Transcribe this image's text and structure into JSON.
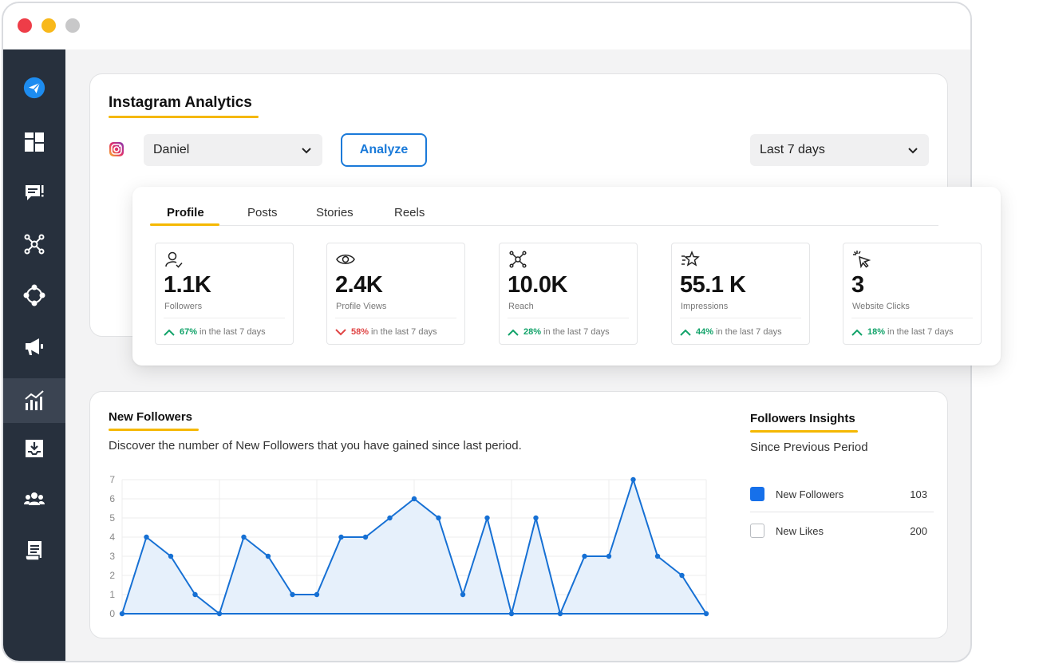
{
  "window": {
    "controls": [
      "close",
      "minimize",
      "maximize"
    ]
  },
  "sidebar": {
    "items": [
      {
        "icon": "paper-plane-logo-icon",
        "active": false
      },
      {
        "icon": "dashboard-grid-icon",
        "active": false
      },
      {
        "icon": "chat-message-icon",
        "active": false
      },
      {
        "icon": "network-hub-icon",
        "active": false
      },
      {
        "icon": "workflow-nodes-icon",
        "active": false
      },
      {
        "icon": "megaphone-icon",
        "active": false
      },
      {
        "icon": "analytics-chart-icon",
        "active": true
      },
      {
        "icon": "inbox-download-icon",
        "active": false
      },
      {
        "icon": "team-users-icon",
        "active": false
      },
      {
        "icon": "report-document-icon",
        "active": false
      }
    ]
  },
  "analytics": {
    "title": "Instagram Analytics",
    "account_select": "Daniel",
    "analyze_label": "Analyze",
    "period_select": "Last 7 days"
  },
  "tabs": [
    "Profile",
    "Posts",
    "Stories",
    "Reels"
  ],
  "metrics": [
    {
      "icon": "user-check-icon",
      "value": "1.1K",
      "label": "Followers",
      "pct": "67%",
      "trend": "up",
      "suffix": "in the last 7 days"
    },
    {
      "icon": "eye-icon",
      "value": "2.4K",
      "label": "Profile Views",
      "pct": "58%",
      "trend": "down",
      "suffix": "in the last 7 days"
    },
    {
      "icon": "reach-nodes-icon",
      "value": "10.0K",
      "label": "Reach",
      "pct": "28%",
      "trend": "up",
      "suffix": "in the last 7 days"
    },
    {
      "icon": "star-sparkle-icon",
      "value": "55.1 K",
      "label": "Impressions",
      "pct": "44%",
      "trend": "up",
      "suffix": "in the last 7 days"
    },
    {
      "icon": "cursor-click-icon",
      "value": "3",
      "label": "Website Clicks",
      "pct": "18%",
      "trend": "up",
      "suffix": "in the last 7 days"
    }
  ],
  "new_followers": {
    "title": "New Followers",
    "description": "Discover the number of New Followers that you have gained since last period."
  },
  "insights": {
    "title": "Followers Insights",
    "subtitle": "Since Previous Period",
    "items": [
      {
        "label": "New Followers",
        "value": "103",
        "checked": true
      },
      {
        "label": "New Likes",
        "value": "200",
        "checked": false
      }
    ]
  },
  "colors": {
    "accent": "#1a7ad9",
    "highlight": "#f5b800",
    "sidebar_bg": "#27303d",
    "up": "#12a36a",
    "down": "#e04545",
    "line": "#1670d4",
    "area": "#e6f0fb"
  },
  "chart_data": {
    "type": "area",
    "title": "",
    "xlabel": "",
    "ylabel": "",
    "ylim": [
      0,
      7
    ],
    "yticks": [
      0,
      1,
      2,
      3,
      4,
      5,
      6,
      7
    ],
    "grid": true,
    "series": [
      {
        "name": "New Followers",
        "values": [
          0,
          4,
          3,
          1,
          0,
          4,
          3,
          1,
          1,
          4,
          4,
          5,
          6,
          5,
          1,
          5,
          0,
          5,
          0,
          3,
          3,
          7,
          3,
          2,
          0
        ]
      }
    ]
  }
}
